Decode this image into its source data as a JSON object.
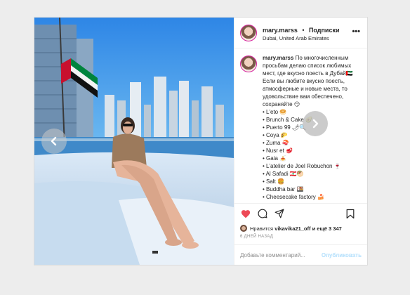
{
  "post": {
    "username": "mary.marss",
    "follow_label": "Подписки",
    "separator": "•",
    "location": "Dubai, United Arab Emirates",
    "more_label": "•••",
    "caption": {
      "username": "mary.marss",
      "text": "По многочисленным просьбам делаю список любимых мест, где вкусно поесть в Дубай🇦🇪 Если вы любите вкусно поесть, атмосферные и новые места, то удовольствие вам обеспечено, сохраняйте 😏",
      "places": [
        "• L'eto 🥯",
        "• Brunch & Cake 🥑",
        "• Puerto 99 🌶🔍",
        "• Coya 🌮",
        "• Zuma 🍣",
        "• Nusr et 🥩",
        "• Gaia 🍝",
        "• L'atelier de Joel Robuchon 🍷",
        "• Al Safadi 🇱🇧🥙",
        "• Salt 🍔",
        "• Buddha bar 🍱",
        "• Cheesecake factory 🍰"
      ]
    },
    "likes_prefix": "Нравится",
    "likes_user": "vikavika21_off",
    "likes_suffix": "и ещё 3 347",
    "time_ago": "6 ДНЕЙ НАЗАД",
    "comment_placeholder": "Добавьте комментарий...",
    "publish_label": "Опубликовать",
    "icons": [
      "heart-icon",
      "comment-icon",
      "share-icon",
      "bookmark-icon",
      "chevron-left-icon",
      "chevron-right-icon"
    ],
    "colors": {
      "liked": "#ed4956",
      "publish": "#b2dffc",
      "avatar_ring": "#d6249f"
    }
  }
}
